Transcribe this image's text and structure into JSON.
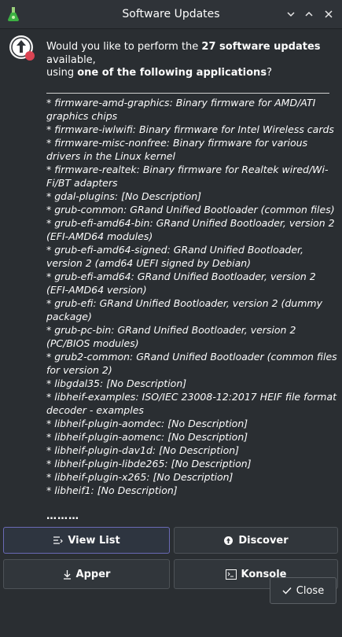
{
  "window": {
    "title": "Software Updates",
    "minimize_icon": "chevron-down-icon",
    "maximize_icon": "chevron-up-icon",
    "close_icon": "close-icon"
  },
  "message": {
    "line1_prefix": "Would you like to perform the ",
    "line1_bold": "27 software updates",
    "line2": "available,",
    "line3_prefix": "using ",
    "line3_bold": "one of the following applications",
    "line3_suffix": "?"
  },
  "packages": [
    "* firmware-amd-graphics: Binary firmware for AMD/ATI graphics chips",
    "* firmware-iwlwifi: Binary firmware for Intel Wireless cards",
    "* firmware-misc-nonfree: Binary firmware for various drivers in the Linux kernel",
    "* firmware-realtek: Binary firmware for Realtek wired/Wi-Fi/BT adapters",
    "* gdal-plugins: [No Description]",
    "* grub-common: GRand Unified Bootloader (common files)",
    "* grub-efi-amd64-bin: GRand Unified Bootloader, version 2 (EFI-AMD64 modules)",
    "* grub-efi-amd64-signed: GRand Unified Bootloader, version 2 (amd64 UEFI signed by Debian)",
    "* grub-efi-amd64: GRand Unified Bootloader, version 2 (EFI-AMD64 version)",
    "* grub-efi: GRand Unified Bootloader, version 2 (dummy package)",
    "* grub-pc-bin: GRand Unified Bootloader, version 2 (PC/BIOS modules)",
    "* grub2-common: GRand Unified Bootloader (common files for version 2)",
    "* libgdal35: [No Description]",
    "* libheif-examples: ISO/IEC 23008-12:2017 HEIF file format decoder - examples",
    "* libheif-plugin-aomdec: [No Description]",
    "* libheif-plugin-aomenc: [No Description]",
    "* libheif-plugin-dav1d: [No Description]",
    "* libheif-plugin-libde265: [No Description]",
    "* libheif-plugin-x265: [No Description]",
    "* libheif1: [No Description]"
  ],
  "ellipsis": "………",
  "buttons": {
    "view_list": "View List",
    "discover": "Discover",
    "apper": "Apper",
    "konsole": "Konsole",
    "close": "Close"
  },
  "colors": {
    "background": "#2a2e32",
    "titlebar": "#2f3338",
    "button": "#31363b",
    "focus_border": "#6a6ab5",
    "alert_red": "#da4453"
  }
}
